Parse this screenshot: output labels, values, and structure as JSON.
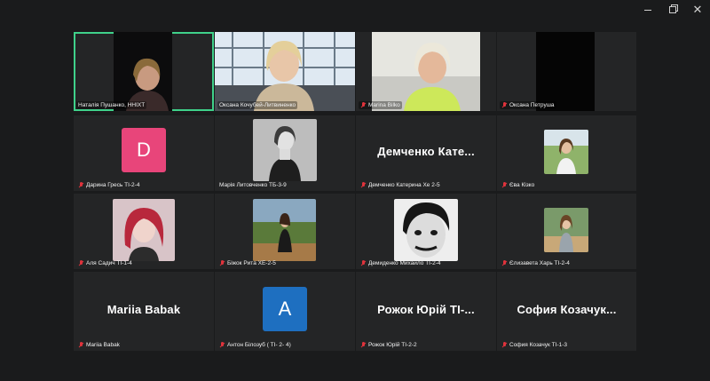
{
  "window": {
    "minimize_glyph": "",
    "maximize_glyph": "",
    "close_glyph": "✕"
  },
  "top_row": [
    {
      "name": "Наталія Пушанко, ННІХТ",
      "active": true
    },
    {
      "name": "Оксана Кочубей-Литвиненко",
      "active": false
    },
    {
      "name": "Marina Bilko",
      "active": false
    },
    {
      "name": "Оксана Петруша",
      "active": false
    }
  ],
  "grid": [
    {
      "id": "daryna",
      "label": "Дарина Гресь ТІ-2-4",
      "avatar_letter": "D",
      "avatar_color": "#e8457a"
    },
    {
      "id": "mariia-l",
      "label": "Марія Литовченко ТБ-3-9"
    },
    {
      "id": "demchenko",
      "label": "Демченко Катерина Хе 2-5",
      "display_name": "Демченко Кате..."
    },
    {
      "id": "eva",
      "label": "Єва Кізко"
    },
    {
      "id": "alia",
      "label": "Аля Садич ТІ-1-4"
    },
    {
      "id": "bizhok",
      "label": "Біжок Рита ХЕ-2-5"
    },
    {
      "id": "demydenko",
      "label": "Демиденко Михайло ТІ-2-4"
    },
    {
      "id": "yelyzaveta",
      "label": "Єлизавета Харь ТІ-2-4"
    },
    {
      "id": "mariia-b",
      "label": "Mariia Babak",
      "display_name": "Mariia Babak"
    },
    {
      "id": "anton",
      "label": "Антон Білозуб ( ТІ- 2- 4)",
      "avatar_letter": "A",
      "avatar_color": "#1e6fc0"
    },
    {
      "id": "rozhok",
      "label": "Рожок Юрій ТІ-2-2",
      "display_name": "Рожок Юрій ТІ-..."
    },
    {
      "id": "sofia",
      "label": "София Козачук ТІ-1-3",
      "display_name": "София Козачук..."
    }
  ]
}
